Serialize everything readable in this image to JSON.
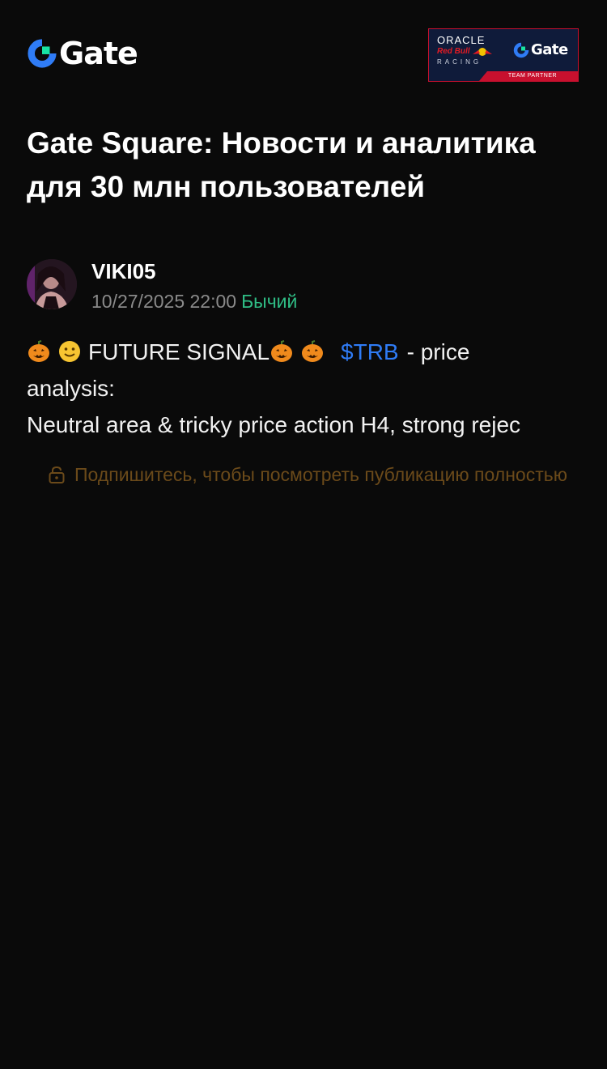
{
  "header": {
    "logo_text": "Gate",
    "partner_badge": {
      "oracle": "ORACLE",
      "redbull": "Red Bull",
      "racing": "RACING",
      "gate": "Gate",
      "strip": "TEAM PARTNER"
    }
  },
  "page": {
    "title": "Gate Square: Новости и аналитика для 30 млн пользователей"
  },
  "post": {
    "author": {
      "name": "VIKI05",
      "timestamp": "10/27/2025 22:00",
      "sentiment": "Бычий"
    },
    "lines": {
      "signal": "FUTURE SIGNAL",
      "ticker": "$TRB",
      "after_ticker": "- price",
      "line2": "analysis:",
      "line3": "Neutral area & tricky price action H4, strong rejec"
    },
    "subscribe_notice": "Подпишитесь, чтобы посмотреть публикацию полностью"
  },
  "colors": {
    "background": "#0a0a0a",
    "brand_blue": "#2f7cf6",
    "brand_green": "#17e3a4",
    "bullish_green": "#2fbd85",
    "locked_text": "#6b4a1a"
  },
  "icons": [
    "gate-logo-icon",
    "pumpkin-icon",
    "smile-icon",
    "lock-icon"
  ]
}
